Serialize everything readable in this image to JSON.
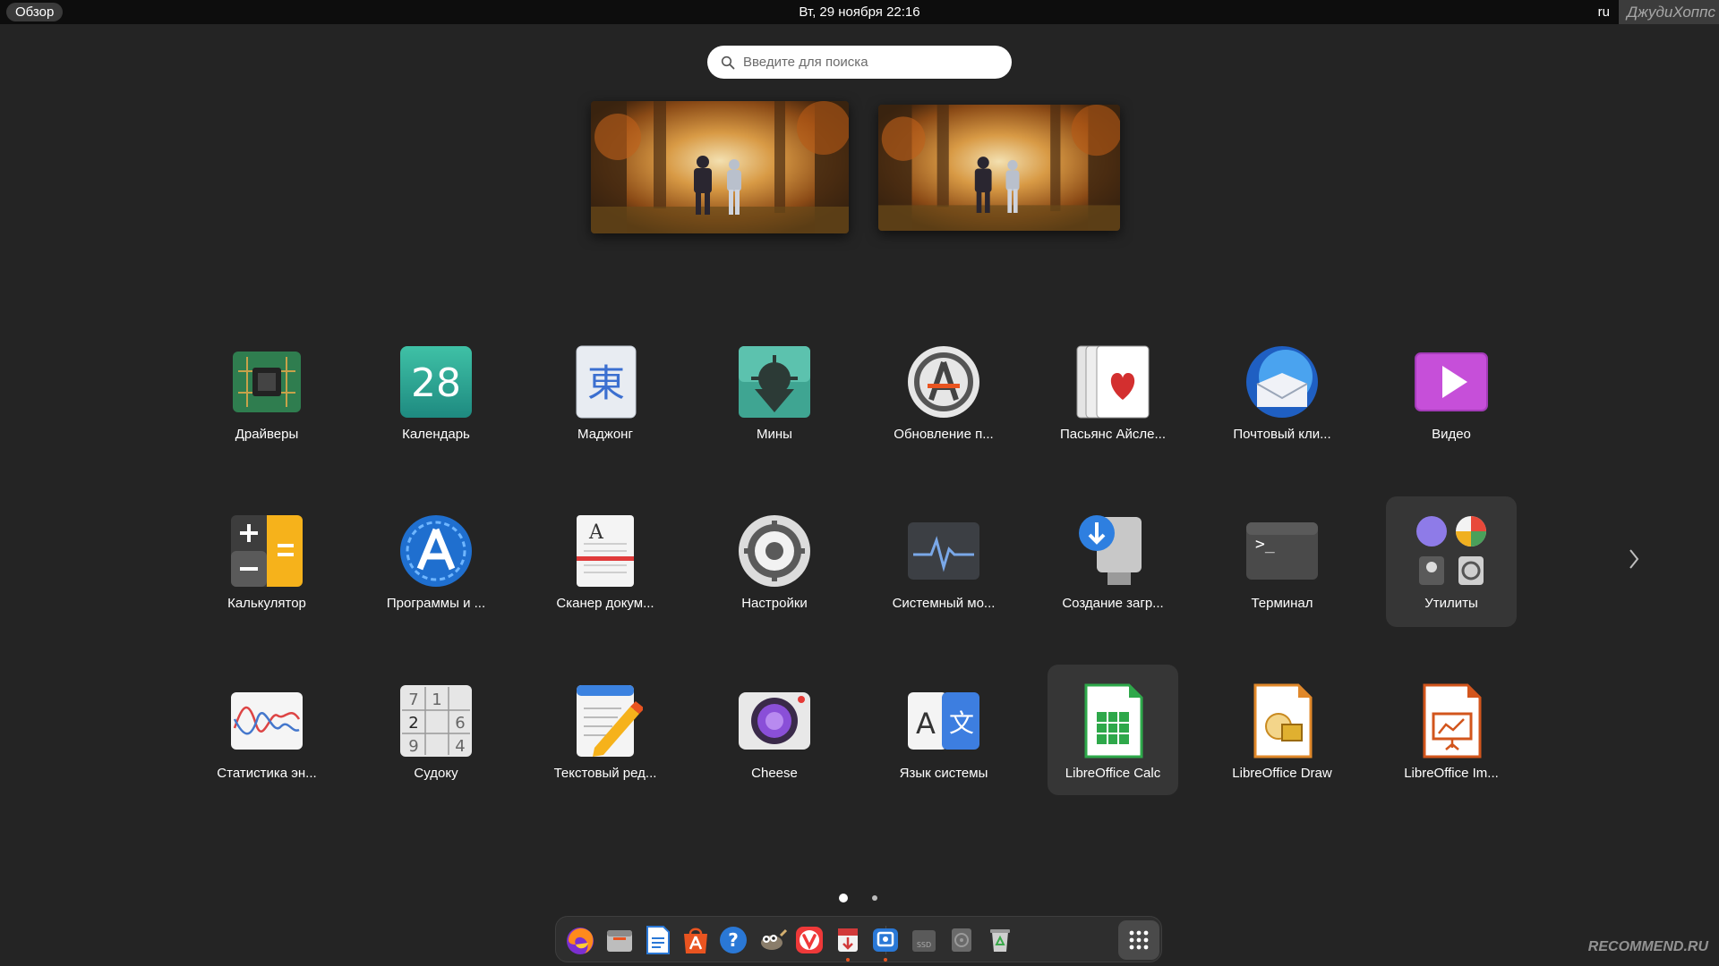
{
  "topbar": {
    "activities": "Обзор",
    "clock": "Вт, 29 ноября  22:16",
    "lang": "ru",
    "watermark": "ДжудиХоппс"
  },
  "search": {
    "placeholder": "Введите для поиска"
  },
  "apps": [
    {
      "label": "Драйверы",
      "icon": "chip-icon"
    },
    {
      "label": "Календарь",
      "icon": "calendar-icon",
      "value": "28"
    },
    {
      "label": "Маджонг",
      "icon": "mahjong-icon",
      "glyph": "東"
    },
    {
      "label": "Мины",
      "icon": "mines-icon"
    },
    {
      "label": "Обновление п...",
      "icon": "software-update-icon"
    },
    {
      "label": "Пасьянс Айсле...",
      "icon": "cards-icon"
    },
    {
      "label": "Почтовый кли...",
      "icon": "thunderbird-icon"
    },
    {
      "label": "Видео",
      "icon": "video-play-icon"
    },
    {
      "label": "Калькулятор",
      "icon": "calculator-icon"
    },
    {
      "label": "Программы и ...",
      "icon": "software-icon"
    },
    {
      "label": "Сканер докум...",
      "icon": "scanner-icon"
    },
    {
      "label": "Настройки",
      "icon": "settings-gear-icon"
    },
    {
      "label": "Системный мо...",
      "icon": "system-monitor-icon"
    },
    {
      "label": "Создание загр...",
      "icon": "usb-creator-icon"
    },
    {
      "label": "Терминал",
      "icon": "terminal-icon",
      "glyph": ">_"
    },
    {
      "label": "Утилиты",
      "icon": "utilities-folder-icon"
    },
    {
      "label": "Статистика эн...",
      "icon": "power-stats-icon"
    },
    {
      "label": "Судоку",
      "icon": "sudoku-icon",
      "digits": [
        "7",
        "1",
        "2",
        "6",
        "9",
        "4"
      ]
    },
    {
      "label": "Текстовый ред...",
      "icon": "text-editor-icon"
    },
    {
      "label": "Cheese",
      "icon": "cheese-camera-icon"
    },
    {
      "label": "Язык системы",
      "icon": "language-icon",
      "glyph_a": "A",
      "glyph_b": "文"
    },
    {
      "label": "LibreOffice Calc",
      "icon": "libreoffice-calc-icon"
    },
    {
      "label": "LibreOffice Draw",
      "icon": "libreoffice-draw-icon"
    },
    {
      "label": "LibreOffice Im...",
      "icon": "libreoffice-impress-icon"
    }
  ],
  "pager": {
    "pages": 2,
    "current": 1
  },
  "dock": [
    {
      "name": "firefox-icon",
      "running": false
    },
    {
      "name": "files-icon",
      "running": false
    },
    {
      "name": "libreoffice-writer-icon",
      "running": false
    },
    {
      "name": "app-center-icon",
      "running": false
    },
    {
      "name": "help-icon",
      "running": false
    },
    {
      "name": "gimp-icon",
      "running": false
    },
    {
      "name": "vivaldi-icon",
      "running": false
    },
    {
      "name": "usb-installer-icon",
      "running": true
    },
    {
      "name": "screenshot-viewer-icon",
      "running": true
    },
    {
      "name": "ssd-drive-icon",
      "running": false,
      "text": "SSD"
    },
    {
      "name": "disk-icon",
      "running": false
    },
    {
      "name": "trash-icon",
      "running": false
    },
    {
      "name": "show-apps-icon",
      "running": false
    }
  ],
  "watermark": "RECOMMEND.RU",
  "colors": {
    "background": "#242424",
    "topbar": "#0d0d0d",
    "accent": "#e95420"
  }
}
